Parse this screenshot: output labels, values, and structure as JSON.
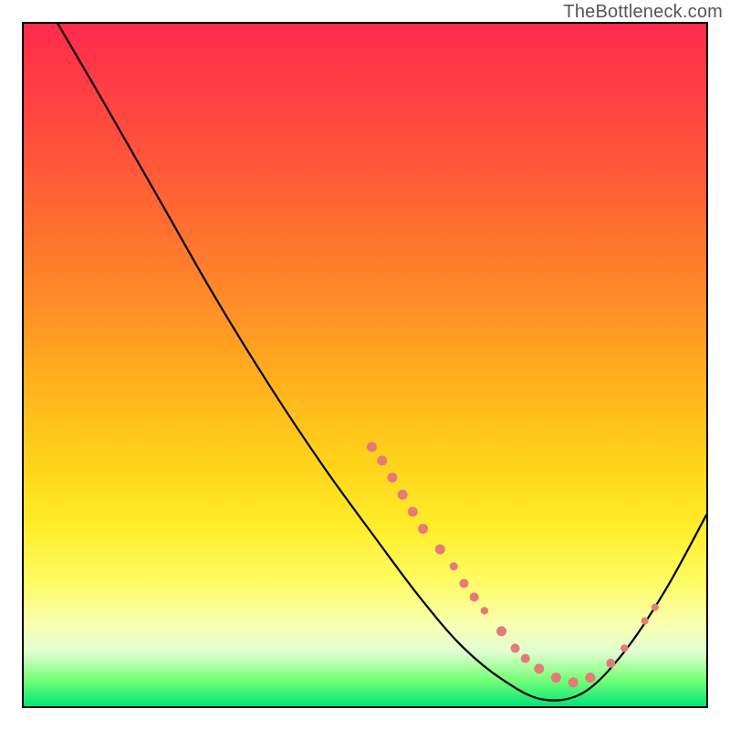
{
  "attribution": "TheBottleneck.com",
  "chart_data": {
    "type": "line",
    "title": "",
    "xlabel": "",
    "ylabel": "",
    "xlim": [
      0,
      100
    ],
    "ylim": [
      0,
      100
    ],
    "grid": false,
    "curve": [
      {
        "x": 5,
        "y": 100
      },
      {
        "x": 12,
        "y": 88
      },
      {
        "x": 20,
        "y": 74
      },
      {
        "x": 28,
        "y": 60
      },
      {
        "x": 36,
        "y": 47
      },
      {
        "x": 44,
        "y": 35
      },
      {
        "x": 52,
        "y": 24
      },
      {
        "x": 58,
        "y": 16
      },
      {
        "x": 64,
        "y": 9
      },
      {
        "x": 70,
        "y": 4
      },
      {
        "x": 76,
        "y": 1
      },
      {
        "x": 82,
        "y": 2
      },
      {
        "x": 88,
        "y": 8
      },
      {
        "x": 94,
        "y": 17
      },
      {
        "x": 100,
        "y": 28
      }
    ],
    "markers": [
      {
        "x": 51,
        "y": 38,
        "r": 5.5
      },
      {
        "x": 52.5,
        "y": 36,
        "r": 5.5
      },
      {
        "x": 54,
        "y": 33.5,
        "r": 5.5
      },
      {
        "x": 55.5,
        "y": 31,
        "r": 5.5
      },
      {
        "x": 57,
        "y": 28.5,
        "r": 5.5
      },
      {
        "x": 58.5,
        "y": 26,
        "r": 5.5
      },
      {
        "x": 61,
        "y": 23,
        "r": 5.5
      },
      {
        "x": 63,
        "y": 20.5,
        "r": 4.5
      },
      {
        "x": 64.5,
        "y": 18,
        "r": 5.0
      },
      {
        "x": 66,
        "y": 16,
        "r": 5.0
      },
      {
        "x": 67.5,
        "y": 14,
        "r": 4.2
      },
      {
        "x": 70,
        "y": 11,
        "r": 5.5
      },
      {
        "x": 72,
        "y": 8.5,
        "r": 5.0
      },
      {
        "x": 73.5,
        "y": 7,
        "r": 5.0
      },
      {
        "x": 75.5,
        "y": 5.5,
        "r": 5.5
      },
      {
        "x": 78,
        "y": 4.2,
        "r": 5.5
      },
      {
        "x": 80.5,
        "y": 3.5,
        "r": 5.5
      },
      {
        "x": 83,
        "y": 4.2,
        "r": 5.5
      },
      {
        "x": 86,
        "y": 6.3,
        "r": 5.0
      },
      {
        "x": 88,
        "y": 8.5,
        "r": 4.2
      },
      {
        "x": 91,
        "y": 12.5,
        "r": 4.0
      },
      {
        "x": 92.5,
        "y": 14.5,
        "r": 4.0
      }
    ]
  }
}
